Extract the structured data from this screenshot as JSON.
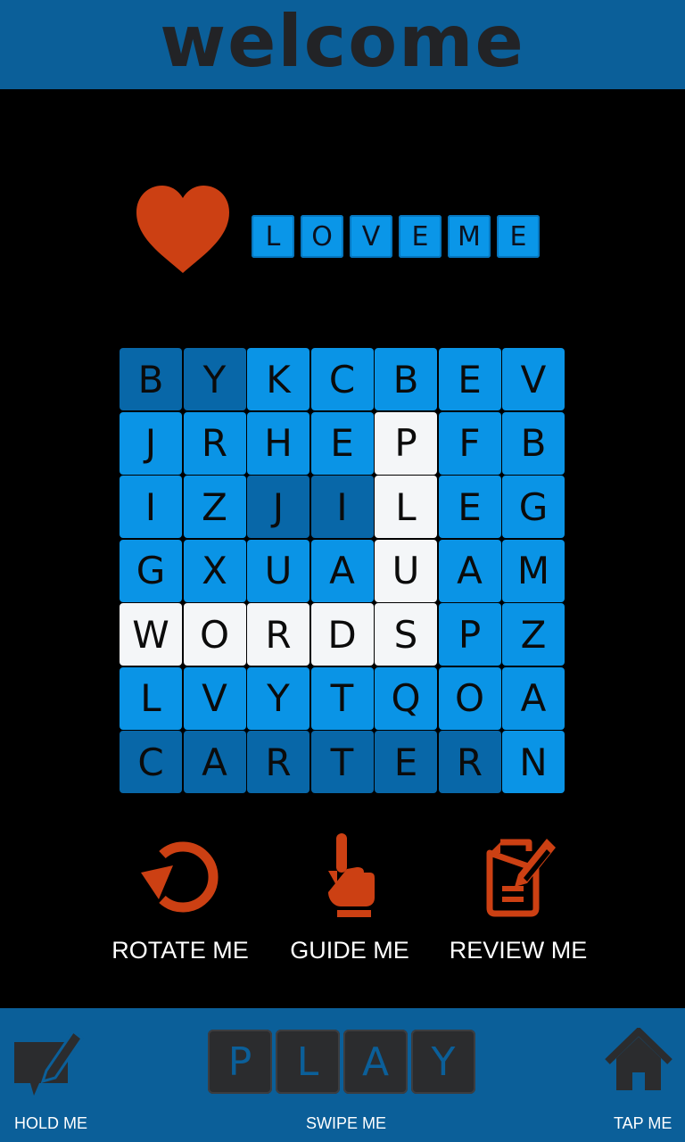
{
  "header": {
    "title": "welcome"
  },
  "hint": {
    "icon": "heart-icon",
    "letters": [
      "L",
      "O",
      "V",
      "E",
      "M",
      "E"
    ]
  },
  "grid": {
    "rows": [
      [
        "B",
        "Y",
        "K",
        "C",
        "B",
        "E",
        "V"
      ],
      [
        "J",
        "R",
        "H",
        "E",
        "P",
        "F",
        "B"
      ],
      [
        "I",
        "Z",
        "J",
        "I",
        "L",
        "E",
        "G"
      ],
      [
        "G",
        "X",
        "U",
        "A",
        "U",
        "A",
        "M"
      ],
      [
        "W",
        "O",
        "R",
        "D",
        "S",
        "P",
        "Z"
      ],
      [
        "L",
        "V",
        "Y",
        "T",
        "Q",
        "O",
        "A"
      ],
      [
        "C",
        "A",
        "R",
        "T",
        "E",
        "R",
        "N"
      ]
    ],
    "states": [
      [
        "dark",
        "dark",
        "light",
        "light",
        "light",
        "light",
        "light"
      ],
      [
        "light",
        "light",
        "light",
        "light",
        "white",
        "light",
        "light"
      ],
      [
        "light",
        "light",
        "dark",
        "dark",
        "white",
        "light",
        "light"
      ],
      [
        "light",
        "light",
        "light",
        "light",
        "white",
        "light",
        "light"
      ],
      [
        "white",
        "white",
        "white",
        "white",
        "white",
        "light",
        "light"
      ],
      [
        "light",
        "light",
        "light",
        "light",
        "light",
        "light",
        "light"
      ],
      [
        "dark",
        "dark",
        "dark",
        "dark",
        "dark",
        "dark",
        "light"
      ]
    ]
  },
  "actions": [
    {
      "label": "ROTATE ME",
      "icon": "rotate-icon"
    },
    {
      "label": "GUIDE ME",
      "icon": "pointing-hand-icon"
    },
    {
      "label": "REVIEW ME",
      "icon": "edit-document-icon"
    }
  ],
  "footer": {
    "play_letters": [
      "P",
      "L",
      "A",
      "Y"
    ],
    "hold_label": "HOLD ME",
    "swipe_label": "SWIPE ME",
    "tap_label": "TAP ME",
    "hold_icon": "chat-edit-icon",
    "tap_icon": "home-icon"
  },
  "colors": {
    "bar_blue": "#0b5f99",
    "tile_blue": "#0a94e6",
    "tile_dark": "#0867a8",
    "tile_selected": "#f4f6f8",
    "accent_orange": "#cc4013"
  }
}
